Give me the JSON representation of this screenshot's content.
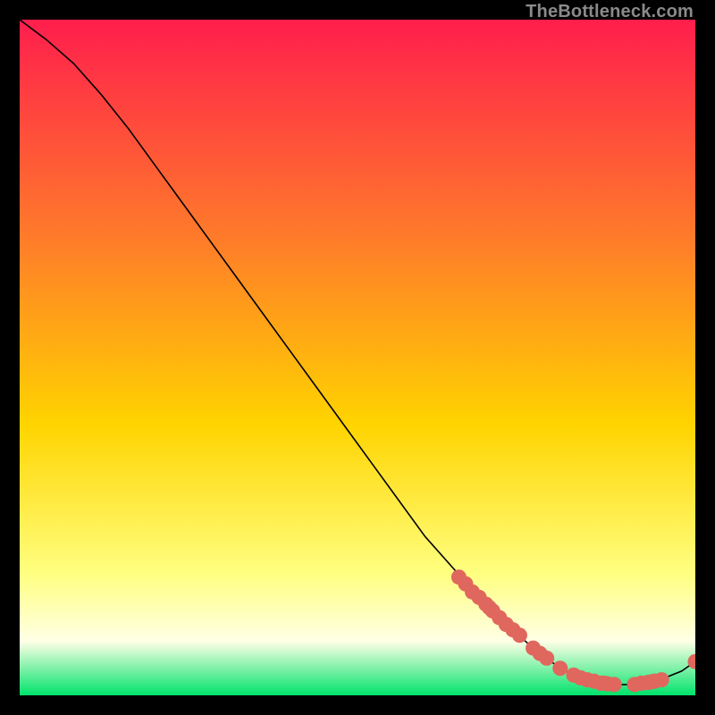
{
  "watermark": "TheBottleneck.com",
  "chart_data": {
    "type": "line",
    "title": "",
    "xlabel": "",
    "ylabel": "",
    "xlim": [
      0,
      100
    ],
    "ylim": [
      0,
      100
    ],
    "grid": false,
    "legend": false,
    "gradient_top": "#ff1e4d",
    "gradient_mid_high": "#ff7a2a",
    "gradient_mid": "#ffd400",
    "gradient_mid_low": "#ffff80",
    "gradient_low": "#ffffe6",
    "gradient_bottom": "#00e36b",
    "x": [
      0,
      4,
      8,
      12,
      16,
      20,
      24,
      28,
      32,
      36,
      40,
      44,
      48,
      52,
      56,
      60,
      64,
      68,
      72,
      76,
      80,
      82,
      84,
      86,
      88,
      90,
      92,
      94,
      96,
      98,
      100
    ],
    "y": [
      100,
      97,
      93.5,
      89,
      84,
      78.5,
      73,
      67.5,
      62,
      56.5,
      51,
      45.5,
      40,
      34.5,
      29,
      23.5,
      19,
      14.5,
      10.5,
      7,
      4,
      3,
      2.3,
      1.8,
      1.6,
      1.6,
      1.8,
      2.1,
      2.8,
      3.6,
      5
    ],
    "markers": {
      "x": [
        65,
        66,
        67,
        68,
        69,
        69.5,
        70,
        71,
        72,
        73,
        74,
        76,
        77,
        78,
        80,
        82,
        83,
        84,
        85,
        86,
        86.5,
        87,
        88,
        91,
        92,
        93,
        93.5,
        94,
        95,
        100
      ],
      "y": [
        17.5,
        16.5,
        15.3,
        14.5,
        13.5,
        13,
        12.5,
        11.5,
        10.5,
        9.7,
        8.9,
        7,
        6.2,
        5.5,
        4,
        3,
        2.6,
        2.3,
        2.1,
        1.8,
        1.8,
        1.7,
        1.6,
        1.6,
        1.8,
        1.9,
        2,
        2.1,
        2.3,
        5
      ],
      "color": "#e0675d",
      "size": 8.5
    }
  }
}
